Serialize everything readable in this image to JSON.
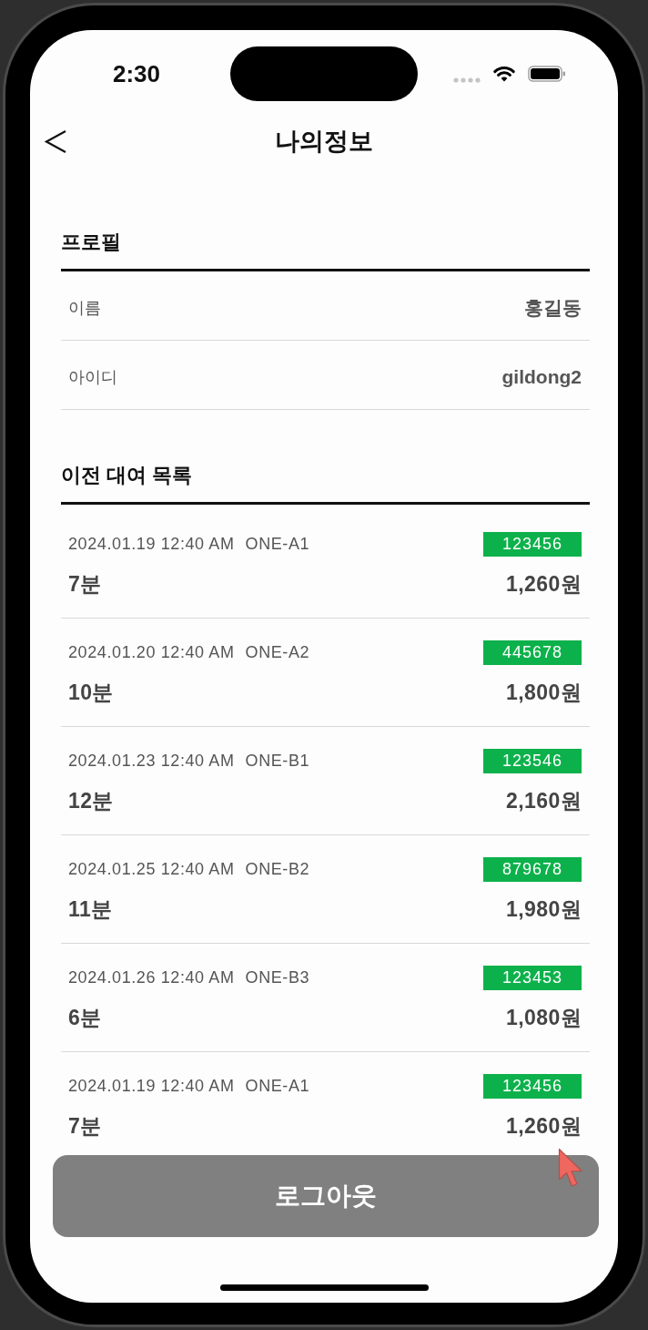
{
  "status_bar": {
    "time": "2:30"
  },
  "nav": {
    "title": "나의정보"
  },
  "profile": {
    "title": "프로필",
    "fields": [
      {
        "label": "이름",
        "value": "홍길동"
      },
      {
        "label": "아이디",
        "value": "gildong2"
      }
    ]
  },
  "rentals": {
    "title": "이전 대여 목록",
    "items": [
      {
        "datetime": "2024.01.19 12:40 AM",
        "device": "ONE-A1",
        "code": "123456",
        "duration": "7분",
        "fee": "1,260원"
      },
      {
        "datetime": "2024.01.20 12:40 AM",
        "device": "ONE-A2",
        "code": "445678",
        "duration": "10분",
        "fee": "1,800원"
      },
      {
        "datetime": "2024.01.23 12:40 AM",
        "device": "ONE-B1",
        "code": "123546",
        "duration": "12분",
        "fee": "2,160원"
      },
      {
        "datetime": "2024.01.25 12:40 AM",
        "device": "ONE-B2",
        "code": "879678",
        "duration": "11분",
        "fee": "1,980원"
      },
      {
        "datetime": "2024.01.26 12:40 AM",
        "device": "ONE-B3",
        "code": "123453",
        "duration": "6분",
        "fee": "1,080원"
      },
      {
        "datetime": "2024.01.19 12:40 AM",
        "device": "ONE-A1",
        "code": "123456",
        "duration": "7분",
        "fee": "1,260원"
      }
    ]
  },
  "logout_button": {
    "label": "로그아웃"
  }
}
